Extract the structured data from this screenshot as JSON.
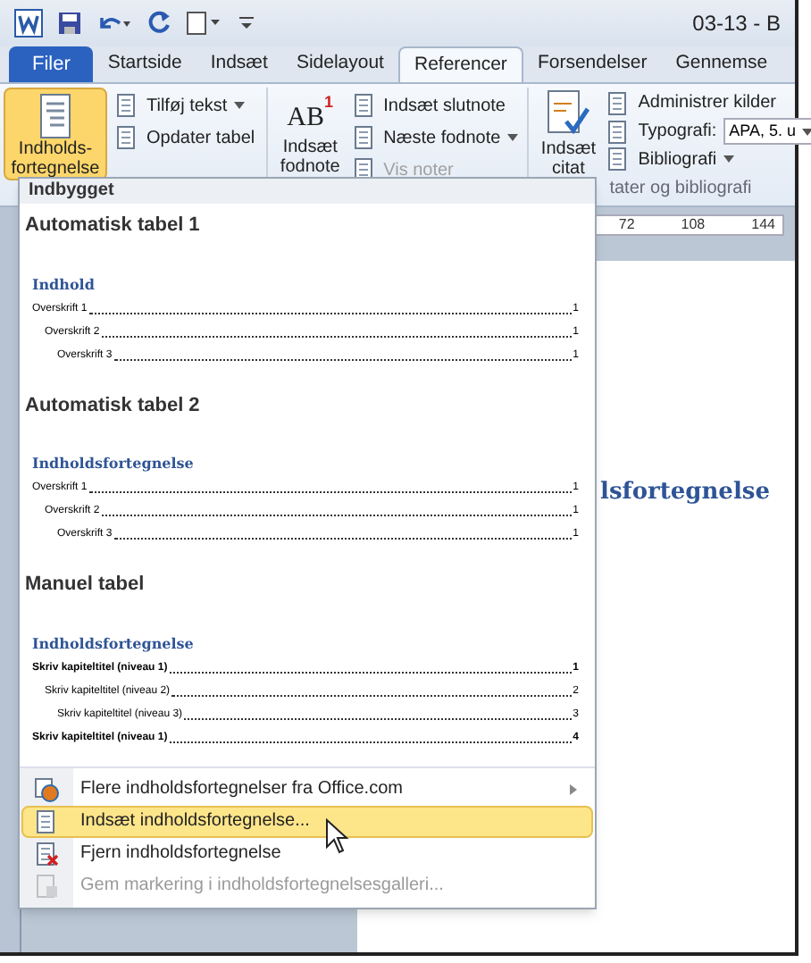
{
  "window": {
    "title": "03-13 - B"
  },
  "tabs": [
    {
      "label": "Filer",
      "kind": "file",
      "selected": false
    },
    {
      "label": "Startside",
      "kind": "tab",
      "selected": false
    },
    {
      "label": "Indsæt",
      "kind": "tab",
      "selected": false
    },
    {
      "label": "Sidelayout",
      "kind": "tab",
      "selected": false
    },
    {
      "label": "Referencer",
      "kind": "tab",
      "selected": true
    },
    {
      "label": "Forsendelser",
      "kind": "tab",
      "selected": false
    },
    {
      "label": "Gennemse",
      "kind": "tab",
      "selected": false
    }
  ],
  "ribbon": {
    "toc_button": {
      "label": "Indholds-fortegnelse",
      "pressed": true
    },
    "toc_small": [
      {
        "label": "Tilføj tekst",
        "dropdown": true,
        "disabled": false
      },
      {
        "label": "Opdater tabel",
        "dropdown": false,
        "disabled": false
      }
    ],
    "footnote_button": {
      "label": "Indsæt fodnote",
      "icon_text": "AB",
      "icon_mark": "1"
    },
    "footnote_small": [
      {
        "label": "Indsæt slutnote",
        "dropdown": false,
        "disabled": false
      },
      {
        "label": "Næste fodnote",
        "dropdown": true,
        "disabled": false
      },
      {
        "label": "Vis noter",
        "dropdown": false,
        "disabled": true
      }
    ],
    "citation_button": {
      "label": "Indsæt citat"
    },
    "citation_small": [
      {
        "label": "Administrer kilder",
        "kind": "button"
      },
      {
        "label": "Typografi:",
        "kind": "select",
        "value": "APA, 5. u"
      },
      {
        "label": "Bibliografi",
        "kind": "dropdown"
      }
    ],
    "group_label": "tater og bibliografi"
  },
  "ruler": [
    "72",
    "108",
    "144"
  ],
  "document": {
    "heading": "lsfortegnelse"
  },
  "menu": {
    "header": "Indbygget",
    "sections": [
      {
        "title": "Automatisk tabel 1",
        "kind": "auto",
        "heading": "Indhold",
        "entries": [
          {
            "text": "Overskrift 1",
            "page": "1",
            "children": [
              {
                "text": "Overskrift 2",
                "page": "1",
                "children": [
                  {
                    "text": "Overskrift 3",
                    "page": "1"
                  }
                ]
              }
            ]
          }
        ]
      },
      {
        "title": "Automatisk tabel 2",
        "kind": "auto",
        "heading": "Indholdsfortegnelse",
        "entries": [
          {
            "text": "Overskrift 1",
            "page": "1",
            "children": [
              {
                "text": "Overskrift 2",
                "page": "1",
                "children": [
                  {
                    "text": "Overskrift 3",
                    "page": "1"
                  }
                ]
              }
            ]
          }
        ]
      },
      {
        "title": "Manuel tabel",
        "kind": "manual",
        "heading": "Indholdsfortegnelse",
        "entries": [
          {
            "text": "Skriv kapiteltitel (niveau 1)",
            "page": "1",
            "children": [
              {
                "text": "Skriv kapiteltitel (niveau 2)",
                "page": "2",
                "children": [
                  {
                    "text": "Skriv kapiteltitel (niveau 3)",
                    "page": "3"
                  }
                ]
              }
            ]
          },
          {
            "text": "Skriv kapiteltitel (niveau 1)",
            "page": "4"
          }
        ]
      }
    ],
    "commands": [
      {
        "label": "Flere indholdsfortegnelser fra Office.com",
        "kind": "web",
        "submenu": true,
        "selected": false,
        "disabled": false
      },
      {
        "label": "Indsæt indholdsfortegnelse...",
        "kind": "insert",
        "submenu": false,
        "selected": true,
        "disabled": false
      },
      {
        "label": "Fjern indholdsfortegnelse",
        "kind": "remove",
        "submenu": false,
        "selected": false,
        "disabled": false
      },
      {
        "label": "Gem markering i indholdsfortegnelsesgalleri...",
        "kind": "save",
        "submenu": false,
        "selected": false,
        "disabled": true
      }
    ]
  }
}
